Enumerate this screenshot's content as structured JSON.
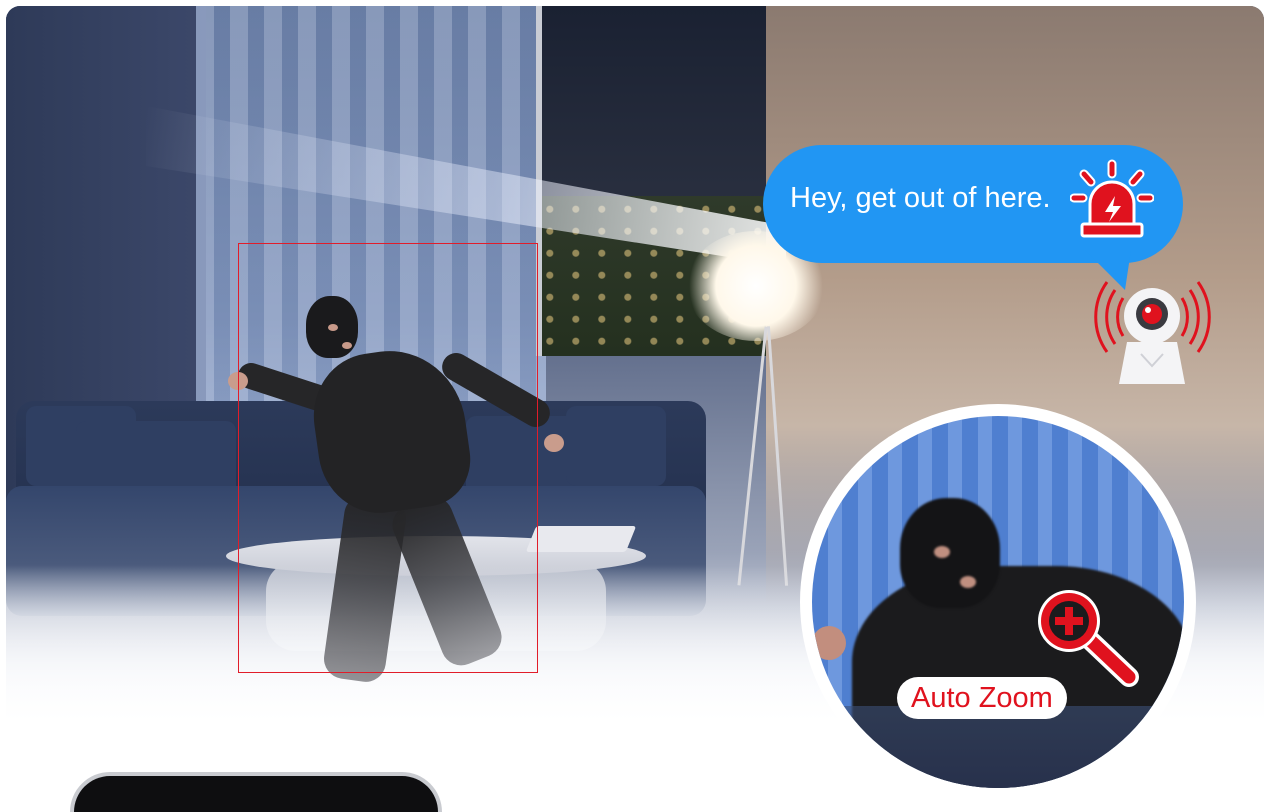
{
  "bubble": {
    "message": "Hey, get out of here."
  },
  "zoom": {
    "label": "Auto Zoom"
  },
  "colors": {
    "bubble_blue": "#2196f3",
    "alert_red": "#e0121e",
    "detection_box": "#e11d2a"
  },
  "icons": {
    "alarm": "alarm-siren-icon",
    "magnifier": "zoom-in-icon",
    "camera": "security-camera-icon"
  }
}
